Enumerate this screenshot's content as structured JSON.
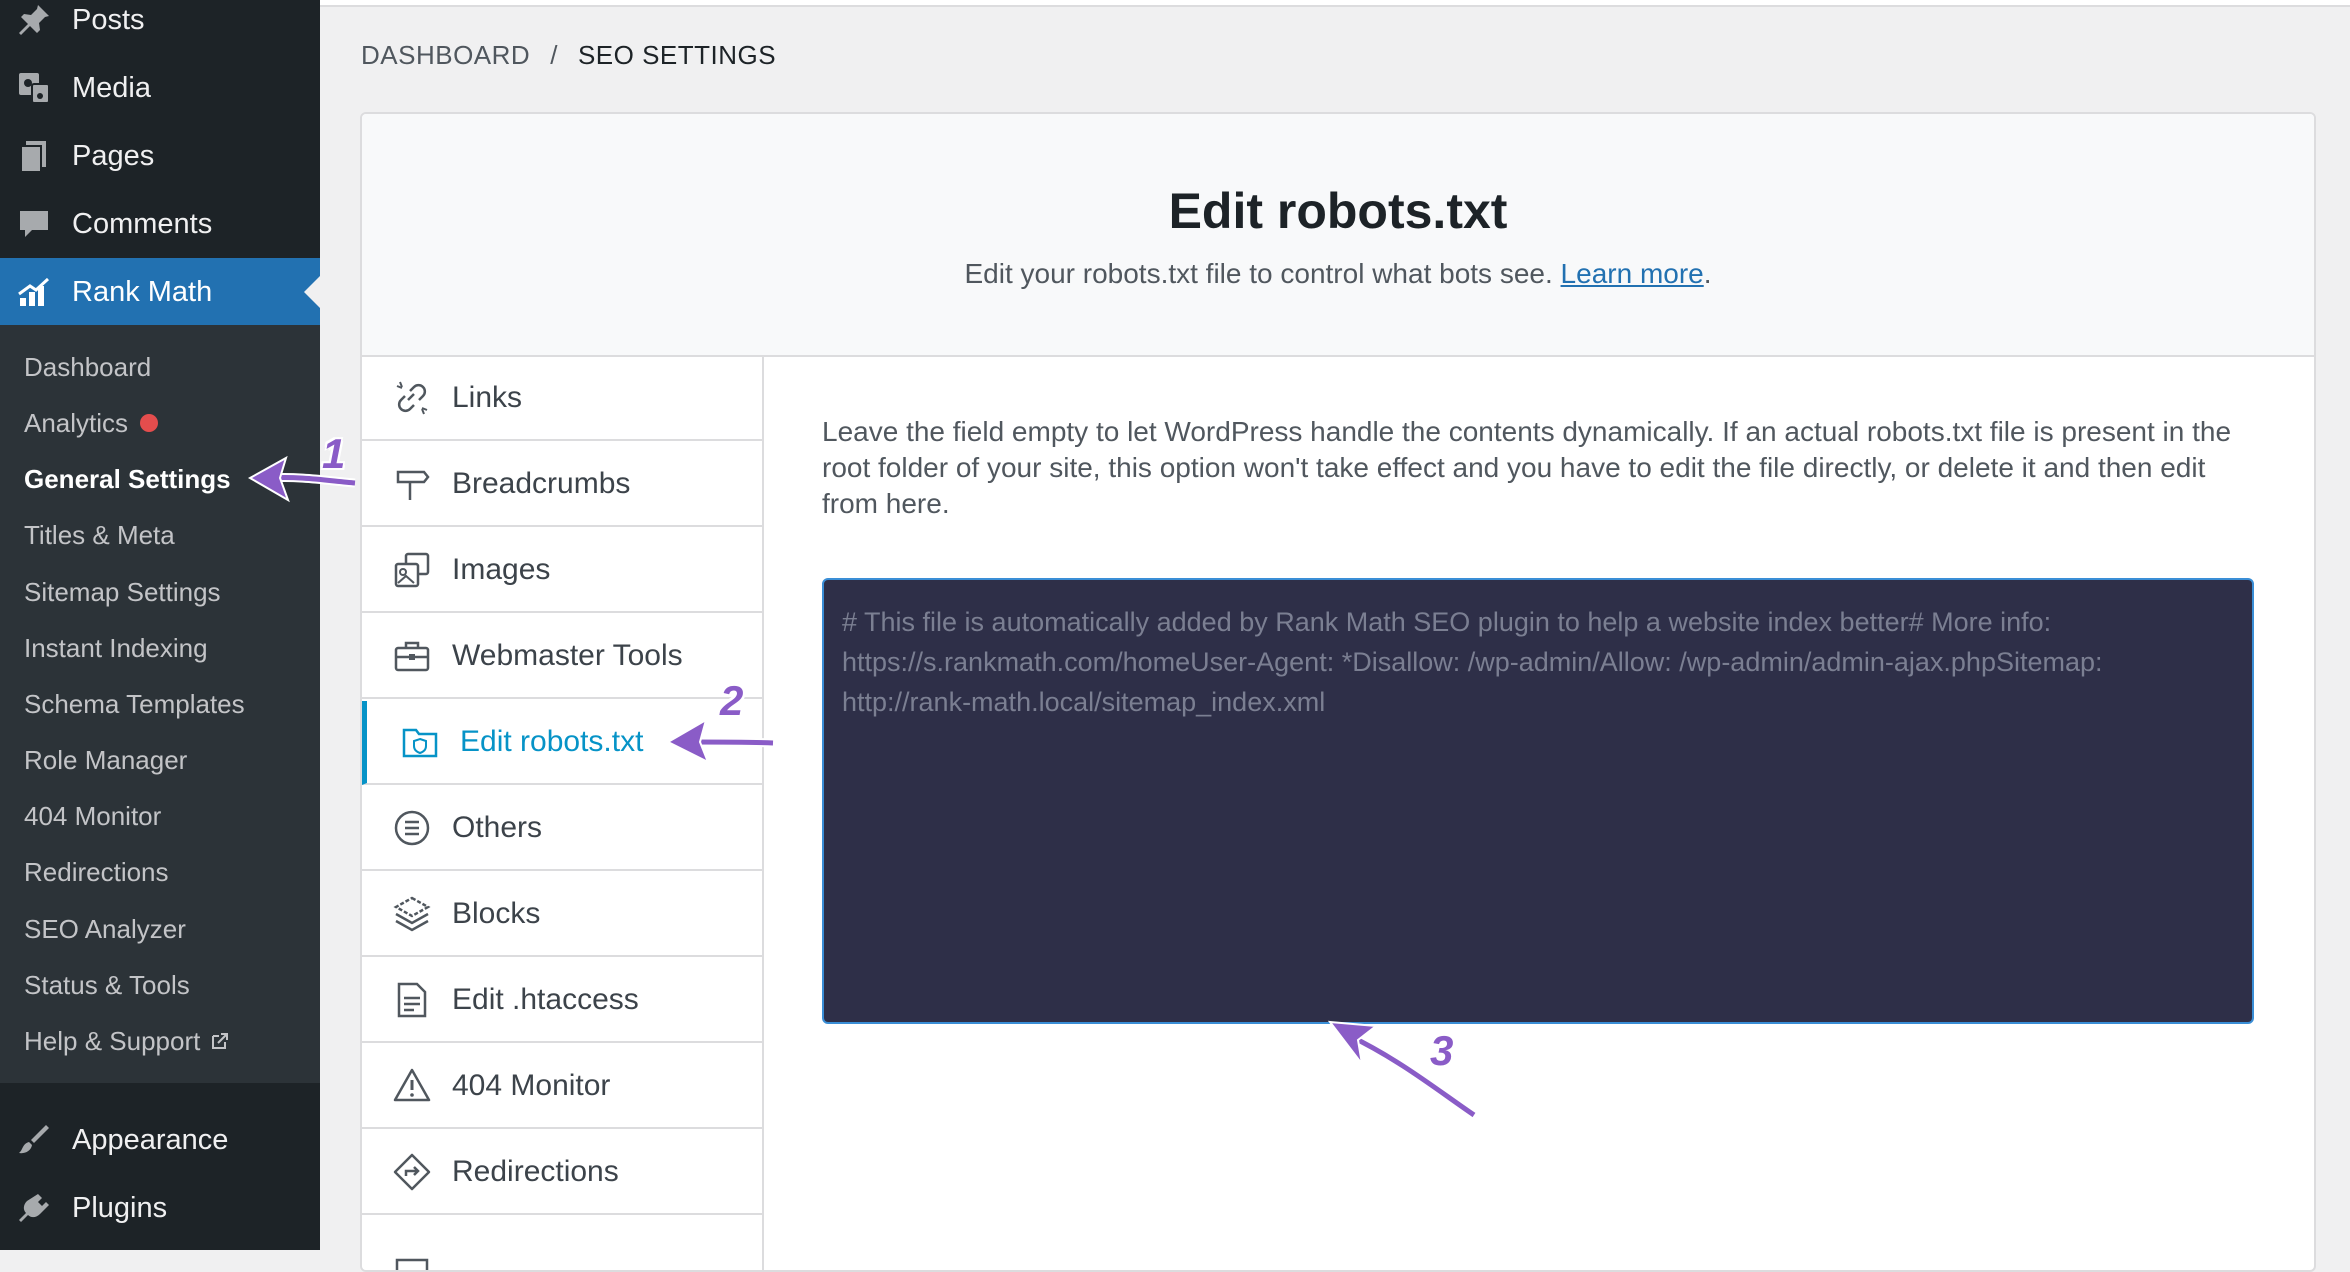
{
  "admin_menu": {
    "top_items": [
      {
        "label": "Posts",
        "icon": "pin-icon"
      },
      {
        "label": "Media",
        "icon": "media-icon"
      },
      {
        "label": "Pages",
        "icon": "pages-icon"
      },
      {
        "label": "Comments",
        "icon": "comment-icon"
      },
      {
        "label": "Rank Math",
        "icon": "rank-math-icon"
      }
    ],
    "submenu": [
      {
        "label": "Dashboard"
      },
      {
        "label": "Analytics"
      },
      {
        "label": "General Settings"
      },
      {
        "label": "Titles & Meta"
      },
      {
        "label": "Sitemap Settings"
      },
      {
        "label": "Instant Indexing"
      },
      {
        "label": "Schema Templates"
      },
      {
        "label": "Role Manager"
      },
      {
        "label": "404 Monitor"
      },
      {
        "label": "Redirections"
      },
      {
        "label": "SEO Analyzer"
      },
      {
        "label": "Status & Tools"
      },
      {
        "label": "Help & Support"
      }
    ],
    "bottom_items": [
      {
        "label": "Appearance",
        "icon": "brush-icon"
      },
      {
        "label": "Plugins",
        "icon": "plug-icon"
      }
    ],
    "accent_color": "#2271b1"
  },
  "breadcrumb": {
    "dashboard": "DASHBOARD",
    "separator": "/",
    "current": "SEO SETTINGS"
  },
  "header": {
    "title": "Edit robots.txt",
    "description": "Edit your robots.txt file to control what bots see.",
    "link_text": "Learn more",
    "trailing": "."
  },
  "tabs": [
    {
      "label": "Links",
      "icon": "links-icon"
    },
    {
      "label": "Breadcrumbs",
      "icon": "signpost-icon"
    },
    {
      "label": "Images",
      "icon": "images-icon"
    },
    {
      "label": "Webmaster Tools",
      "icon": "toolbox-icon"
    },
    {
      "label": "Edit robots.txt",
      "icon": "folder-shield-icon",
      "active": true
    },
    {
      "label": "Others",
      "icon": "list-circle-icon"
    },
    {
      "label": "Blocks",
      "icon": "blocks-icon"
    },
    {
      "label": "Edit .htaccess",
      "icon": "file-text-icon"
    },
    {
      "label": "404 Monitor",
      "icon": "warning-icon"
    },
    {
      "label": "Redirections",
      "icon": "redirect-icon"
    }
  ],
  "content": {
    "help_text": "Leave the field empty to let WordPress handle the contents dynamically. If an actual robots.txt file is present in the root folder of your site, this option won't take effect and you have to edit the file directly, or delete it and then edit from here.",
    "editor_placeholder": "# This file is automatically added by Rank Math SEO plugin to help a website index better# More info: https://s.rankmath.com/homeUser-Agent: *Disallow: /wp-admin/Allow: /wp-admin/admin-ajax.phpSitemap: http://rank-math.local/sitemap_index.xml"
  },
  "callouts": [
    "1",
    "2",
    "3"
  ],
  "colors": {
    "active_tab": "#0693c7",
    "editor_bg": "#2e2f48",
    "callout": "#8a5cc7"
  }
}
